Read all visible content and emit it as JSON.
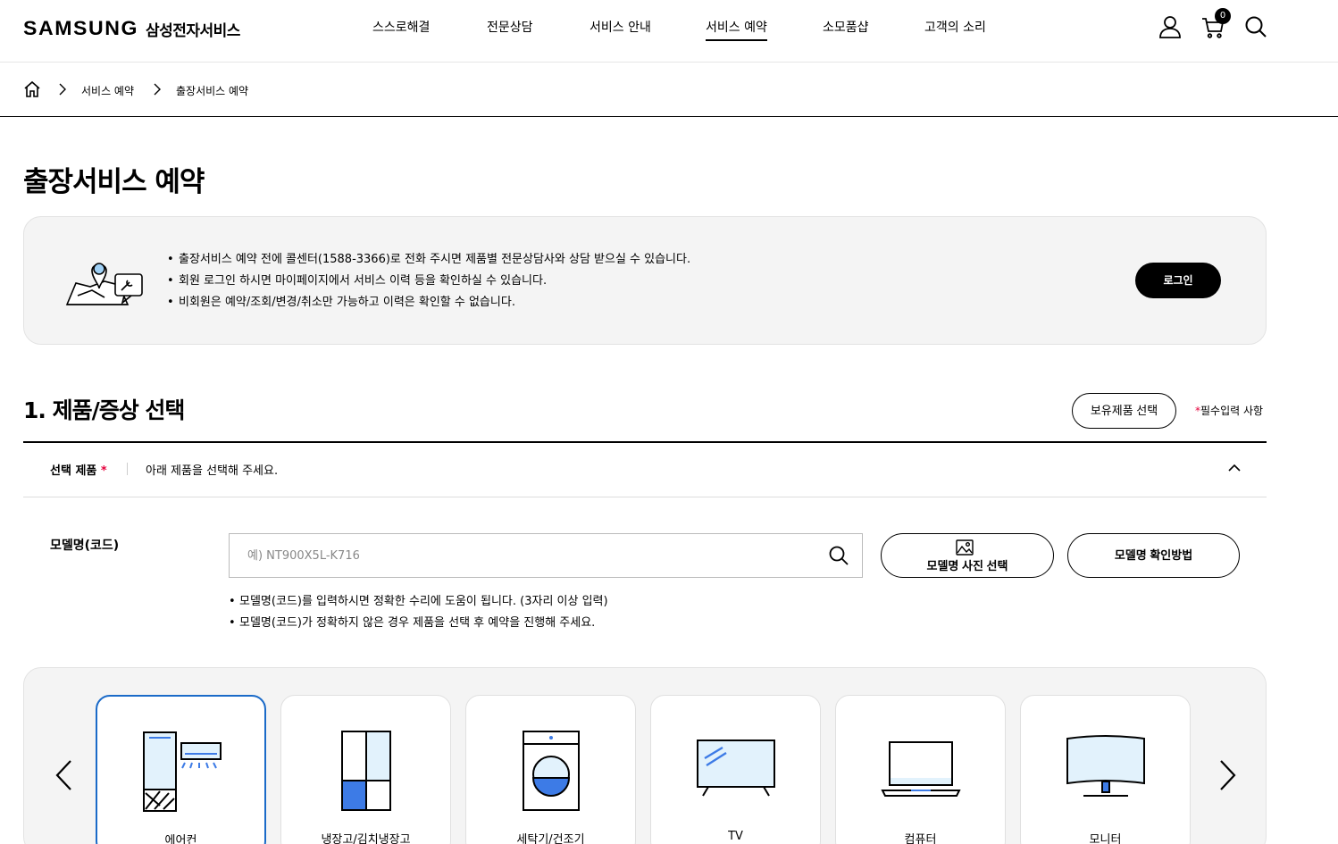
{
  "header": {
    "logo_word": "SAMSUNG",
    "logo_sub": "삼성전자서비스",
    "nav": [
      "스스로해결",
      "전문상담",
      "서비스 안내",
      "서비스 예약",
      "소모품샵",
      "고객의 소리"
    ],
    "active_nav_index": 3,
    "cart_count": "0",
    "icons": [
      "user-icon",
      "cart-icon",
      "search-icon"
    ]
  },
  "breadcrumb": {
    "items": [
      "서비스 예약",
      "출장서비스 예약"
    ]
  },
  "page_title": "출장서비스 예약",
  "notice": {
    "lines": [
      "출장서비스 예약 전에 콜센터(1588-3366)로 전화 주시면 제품별 전문상담사와 상담 받으실 수 있습니다.",
      "회원 로그인 하시면 마이페이지에서 서비스 이력 등을 확인하실 수 있습니다.",
      "비회원은 예약/조회/변경/취소만 가능하고 이력은 확인할 수 없습니다."
    ],
    "login_label": "로그인"
  },
  "section": {
    "title": "1. 제품/증상 선택",
    "owned_button": "보유제품 선택",
    "required_star": "*",
    "required_note": "필수입력 사항",
    "select_label": "선택 제품",
    "select_star": "*",
    "select_message": "아래 제품을 선택해 주세요."
  },
  "model": {
    "label": "모델명(코드)",
    "placeholder": "예) NT900X5L-K716",
    "value": "",
    "photo_button": "모델명 사진 선택",
    "how_button": "모델명 확인방법",
    "tips": [
      "모델명(코드)를 입력하시면 정확한 수리에 도움이 됩니다. (3자리 이상 입력)",
      "모델명(코드)가 정확하지 않은 경우 제품을 선택 후 예약을 진행해 주세요."
    ]
  },
  "products": [
    {
      "label": "에어컨",
      "icon": "air-conditioner-icon",
      "selected": true
    },
    {
      "label": "냉장고/김치냉장고",
      "icon": "refrigerator-icon",
      "selected": false
    },
    {
      "label": "세탁기/건조기",
      "icon": "washing-machine-icon",
      "selected": false
    },
    {
      "label": "TV",
      "icon": "tv-icon",
      "selected": false
    },
    {
      "label": "컴퓨터",
      "icon": "laptop-icon",
      "selected": false
    },
    {
      "label": "모니터",
      "icon": "monitor-icon",
      "selected": false
    }
  ],
  "colors": {
    "accent_blue": "#1a6ac8",
    "icon_blue": "#3d7be6",
    "icon_light_blue": "#e2f2fc",
    "required_red": "#e5003c",
    "panel_gray": "#f4f4f4"
  }
}
